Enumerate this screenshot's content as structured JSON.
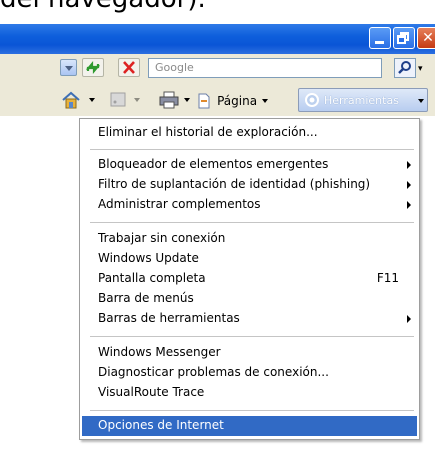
{
  "caption": "del navegador).",
  "window": {
    "min_icon": "minimize-icon",
    "max_icon": "restore-icon",
    "close_icon": "close-icon"
  },
  "address_bar": {
    "search_placeholder": "Google"
  },
  "command_bar": {
    "page_label": "Página",
    "tools_label": "Herramientas"
  },
  "menu": {
    "items": [
      {
        "label": "Eliminar el historial de exploración..."
      },
      {
        "label": "Bloqueador de elementos emergentes"
      },
      {
        "label": "Filtro de suplantación de identidad (phishing)"
      },
      {
        "label": "Administrar complementos"
      },
      {
        "label": "Trabajar sin conexión"
      },
      {
        "label": "Windows Update"
      },
      {
        "label": "Pantalla completa",
        "shortcut": "F11"
      },
      {
        "label": "Barra de menús"
      },
      {
        "label": "Barras de herramientas"
      },
      {
        "label": "Windows Messenger"
      },
      {
        "label": "Diagnosticar problemas de conexión..."
      },
      {
        "label": "VisualRoute Trace"
      },
      {
        "label": "Opciones de Internet"
      }
    ]
  },
  "colors": {
    "titlebar": "#0a55d6",
    "highlight": "#316ac5",
    "toolbar_bg": "#ece9d8"
  }
}
